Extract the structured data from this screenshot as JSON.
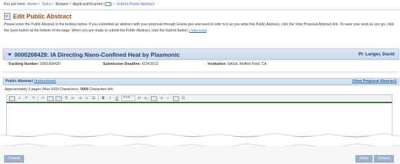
{
  "breadcrumb": {
    "prefix": "You are here:",
    "home": "Home",
    "tasks": "Tasks",
    "browse": "Browse",
    "applicant": "Applicant/Grantee",
    "current": "Submit Public Abstract"
  },
  "page": {
    "title": "Edit Public Abstract",
    "instructions": "Please enter the Public Abstract in the textbox below. If you submitted an abstract with your proposal through Grants.gov and want to refer to it as you write this Public Abstract, click the View Proposal Abstract link. To save your work as you go, click the Save button at the bottom of the page. When you are ready to submit the Public Abstract, click the Submit button.",
    "view_less": "( View Less)"
  },
  "project": {
    "title": "0000208429: IA Directing Nano-Confined Heat by Plasmonic",
    "pi": "PI: Langer, David",
    "tracking_label": "Tracking Number:",
    "tracking_value": "0000208429",
    "deadline_label": "Submission Deadline:",
    "deadline_value": "6/24/2013",
    "institution_label": "Institution:",
    "institution_value": "NASA, Moffett Field, CA"
  },
  "abstract_section": {
    "label": "Public Abstract",
    "instructions_link": "(Instructions)",
    "view_proposal_link": "(View Proposal Abstract)",
    "limit_text": "Approximately 3 pages (Max 5000 Characters):",
    "chars_left_value": "5000",
    "chars_left_suffix": "Characters left."
  },
  "toolbar": {
    "font_label": "Font...",
    "bold": "B",
    "italic": "I",
    "underline": "U",
    "superscript": "x²",
    "subscript": "x₂",
    "omega": "Ω"
  },
  "buttons": {
    "cancel": "Cancel",
    "save": "Save",
    "submit": "Submit"
  }
}
